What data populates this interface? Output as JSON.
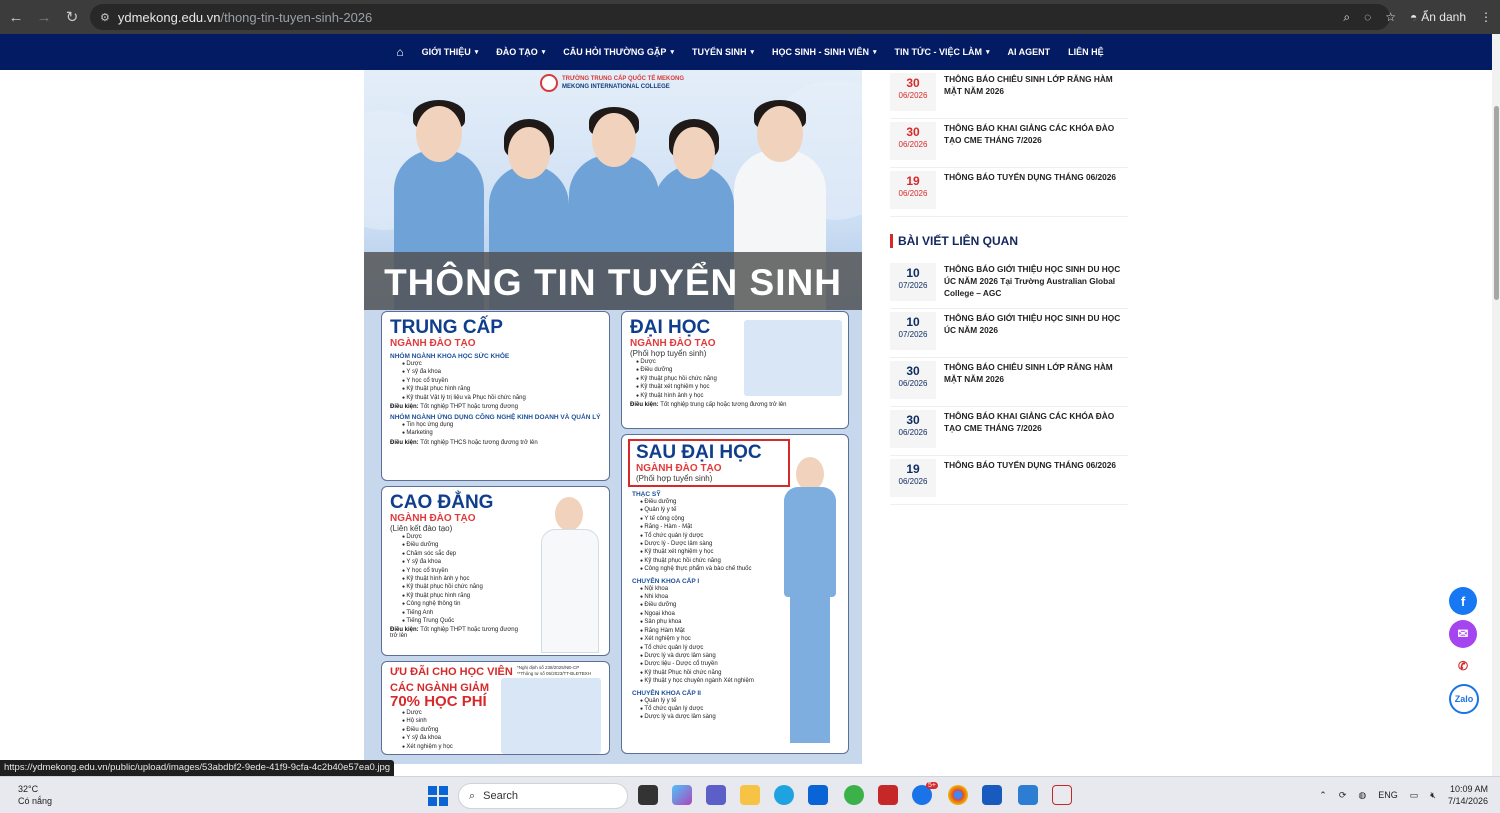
{
  "browser": {
    "url_site": "ydmekong.edu.vn",
    "url_path": "/thong-tin-tuyen-sinh-2026",
    "incognito_label": "Ẩn danh"
  },
  "nav": {
    "items": [
      {
        "label": "GIỚI THIỆU",
        "caret": true
      },
      {
        "label": "ĐÀO TẠO",
        "caret": true
      },
      {
        "label": "CÂU HỎI THƯỜNG GẶP",
        "caret": true
      },
      {
        "label": "TUYỂN SINH",
        "caret": true
      },
      {
        "label": "HỌC SINH - SINH VIÊN",
        "caret": true
      },
      {
        "label": "TIN TỨC - VIỆC LÀM",
        "caret": true
      },
      {
        "label": "AI AGENT",
        "caret": false
      },
      {
        "label": "LIÊN HỆ",
        "caret": false
      }
    ]
  },
  "poster": {
    "logo_line1": "TRƯỜNG TRUNG CẤP QUỐC TẾ MEKONG",
    "logo_line2": "MEKONG INTERNATIONAL COLLEGE",
    "title": "THÔNG TIN TUYỂN SINH",
    "trung_cap": {
      "heading": "TRUNG CẤP",
      "sub": "NGÀNH ĐÀO TẠO",
      "group1": "NHÓM NGÀNH KHOA HỌC SỨC KHỎE",
      "list1": [
        "Dược",
        "Y sỹ đa khoa",
        "Y học cổ truyền",
        "Kỹ thuật phục hình răng",
        "Kỹ thuật Vật lý trị liệu và Phục hồi chức năng"
      ],
      "cond_label": "Điều kiện:",
      "cond1": "Tốt nghiệp THPT hoặc tương đương",
      "group2": "NHÓM NGÀNH ỨNG DỤNG CÔNG NGHỆ KINH DOANH VÀ QUẢN LÝ",
      "list2": [
        "Tin học ứng dụng",
        "Marketing"
      ],
      "cond2": "Tốt nghiệp THCS hoặc tương đương trở lên"
    },
    "dai_hoc": {
      "heading": "ĐẠI HỌC",
      "sub": "NGÀNH ĐÀO TẠO",
      "paren": "(Phối hợp tuyển sinh)",
      "list": [
        "Dược",
        "Điều dưỡng",
        "Kỹ thuật phục hồi chức năng",
        "Kỹ thuật xét nghiệm y học",
        "Kỹ thuật hình ảnh y học"
      ],
      "cond_label": "Điều kiện:",
      "cond": "Tốt nghiệp trung cấp hoặc tương đương trở lên"
    },
    "cao_dang": {
      "heading": "CAO ĐẲNG",
      "sub": "NGÀNH ĐÀO TẠO",
      "paren": "(Liên kết đào tạo)",
      "list": [
        "Dược",
        "Điều dưỡng",
        "Chăm sóc sắc đẹp",
        "Y sỹ đa khoa",
        "Y học cổ truyền",
        "Kỹ thuật hình ảnh y học",
        "Kỹ thuật phục hồi chức năng",
        "Kỹ thuật phục hình răng",
        "Công nghệ thông tin",
        "Tiếng Anh",
        "Tiếng Trung Quốc"
      ],
      "cond_label": "Điều kiện:",
      "cond": "Tốt nghiệp THPT hoặc tương đương trở lên"
    },
    "sau_dai_hoc": {
      "heading": "SAU ĐẠI HỌC",
      "sub": "NGÀNH ĐÀO TẠO",
      "paren": "(Phối hợp tuyển sinh)",
      "group1": "THẠC SỸ",
      "list1": [
        "Điều dưỡng",
        "Quản lý y tế",
        "Y tế công cộng",
        "Răng - Hàm - Mặt",
        "Tổ chức quản lý dược",
        "Dược lý - Dược lâm sàng",
        "Kỹ thuật xét nghiệm y học",
        "Kỹ thuật phục hồi chức năng",
        "Công nghệ thực phẩm và bào chế thuốc"
      ],
      "group2": "CHUYÊN KHOA CẤP I",
      "list2": [
        "Nội khoa",
        "Nhi khoa",
        "Điều dưỡng",
        "Ngoại khoa",
        "Sản phụ khoa",
        "Răng Hàm Mặt",
        "Xét nghiệm y học",
        "Tổ chức quản lý dược",
        "Dược lý và dược lâm sàng",
        "Dược liệu - Dược cổ truyền",
        "Kỹ thuật Phục hồi chức năng",
        "Kỹ thuật y học chuyên ngành Xét nghiệm"
      ],
      "group3": "CHUYÊN KHOA CẤP II",
      "list3": [
        "Quản lý y tế",
        "Tổ chức quản lý dược",
        "Dược lý và dược lâm sàng"
      ]
    },
    "uu_dai": {
      "heading": "ƯU ĐÃI CHO HỌC VIÊN",
      "note1": "*Nghị định số 238/2025/NĐ-CP",
      "note2": "**Thông tư số 05/2023/TT-BLĐTBXH",
      "sub": "CÁC NGÀNH GIẢM",
      "big": "70% HỌC PHÍ",
      "list": [
        "Dược",
        "Hộ sinh",
        "Điều dưỡng",
        "Y sỹ đa khoa",
        "Xét nghiệm y học"
      ]
    }
  },
  "sidebar": {
    "top_news": [
      {
        "day": "30",
        "month": "06/2026",
        "title": "THÔNG BÁO CHIÊU SINH LỚP RĂNG HÀM MẶT NĂM 2026"
      },
      {
        "day": "30",
        "month": "06/2026",
        "title": "THÔNG BÁO KHAI GIẢNG CÁC KHÓA ĐÀO TẠO CME THÁNG 7/2026"
      },
      {
        "day": "19",
        "month": "06/2026",
        "title": "THÔNG BÁO TUYỂN DỤNG THÁNG 06/2026"
      }
    ],
    "related_title": "BÀI VIẾT LIÊN QUAN",
    "related": [
      {
        "day": "10",
        "month": "07/2026",
        "title": "THÔNG BÁO GIỚI THIỆU HỌC SINH DU HỌC ÚC NĂM 2026 Tại Trường Australian Global College – AGC"
      },
      {
        "day": "10",
        "month": "07/2026",
        "title": "THÔNG BÁO GIỚI THIỆU HỌC SINH DU HỌC ÚC NĂM 2026"
      },
      {
        "day": "30",
        "month": "06/2026",
        "title": "THÔNG BÁO CHIÊU SINH LỚP RĂNG HÀM MẶT NĂM 2026"
      },
      {
        "day": "30",
        "month": "06/2026",
        "title": "THÔNG BÁO KHAI GIẢNG CÁC KHÓA ĐÀO TẠO CME THÁNG 7/2026"
      },
      {
        "day": "19",
        "month": "06/2026",
        "title": "THÔNG BÁO TUYỂN DỤNG THÁNG 06/2026"
      }
    ]
  },
  "social": {
    "zalo_label": "Zalo"
  },
  "status_url": "https://ydmekong.edu.vn/public/upload/images/53abdbf2-9ede-41f9-9cfa-4c2b40e57ea0.jpg",
  "taskbar": {
    "weather_temp": "32°C",
    "weather_desc": "Có nắng",
    "search_placeholder": "Search",
    "lang": "ENG",
    "time": "10:09 AM",
    "date": "7/14/2026",
    "badge": "5+"
  }
}
